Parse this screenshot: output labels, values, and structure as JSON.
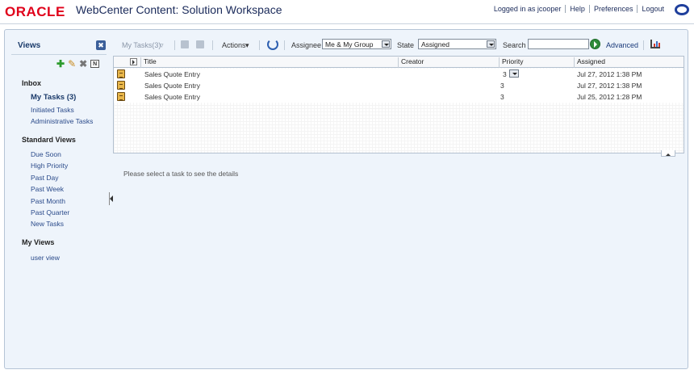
{
  "header": {
    "logo_text": "ORACLE",
    "app_title": "WebCenter Content: Solution Workspace",
    "logged_in": "Logged in as jcooper",
    "help": "Help",
    "preferences": "Preferences",
    "logout": "Logout"
  },
  "left_panel": {
    "title": "Views",
    "close_label": "✖",
    "n_label": "N",
    "inbox": {
      "heading": "Inbox",
      "items": [
        "My Tasks (3)",
        "Initiated Tasks",
        "Administrative Tasks"
      ]
    },
    "standard_views": {
      "heading": "Standard Views",
      "items": [
        "Due Soon",
        "High Priority",
        "Past Day",
        "Past Week",
        "Past Month",
        "Past Quarter",
        "New Tasks"
      ]
    },
    "my_views": {
      "heading": "My Views",
      "items": [
        "user view"
      ]
    }
  },
  "toolbar": {
    "my_tasks": "My Tasks(3)",
    "actions": "Actions",
    "assignee_label": "Assignee",
    "assignee_value": "Me & My Group",
    "state_label": "State",
    "state_value": "Assigned",
    "search_label": "Search",
    "search_value": "",
    "advanced": "Advanced"
  },
  "table": {
    "columns": [
      "Title",
      "Creator",
      "Priority",
      "Assigned"
    ],
    "rows": [
      {
        "title": "Sales Quote Entry",
        "creator": "",
        "priority": "3",
        "assigned": "Jul 27, 2012 1:38 PM"
      },
      {
        "title": "Sales Quote Entry",
        "creator": "",
        "priority": "3",
        "assigned": "Jul 27, 2012 1:38 PM"
      },
      {
        "title": "Sales Quote Entry",
        "creator": "",
        "priority": "3",
        "assigned": "Jul 25, 2012 1:28 PM"
      }
    ]
  },
  "details_message": "Please select a task to see the details",
  "colors": {
    "oracle_red": "#e0001a",
    "link_blue": "#2a4a8a",
    "panel_bg": "#eef4fb"
  }
}
